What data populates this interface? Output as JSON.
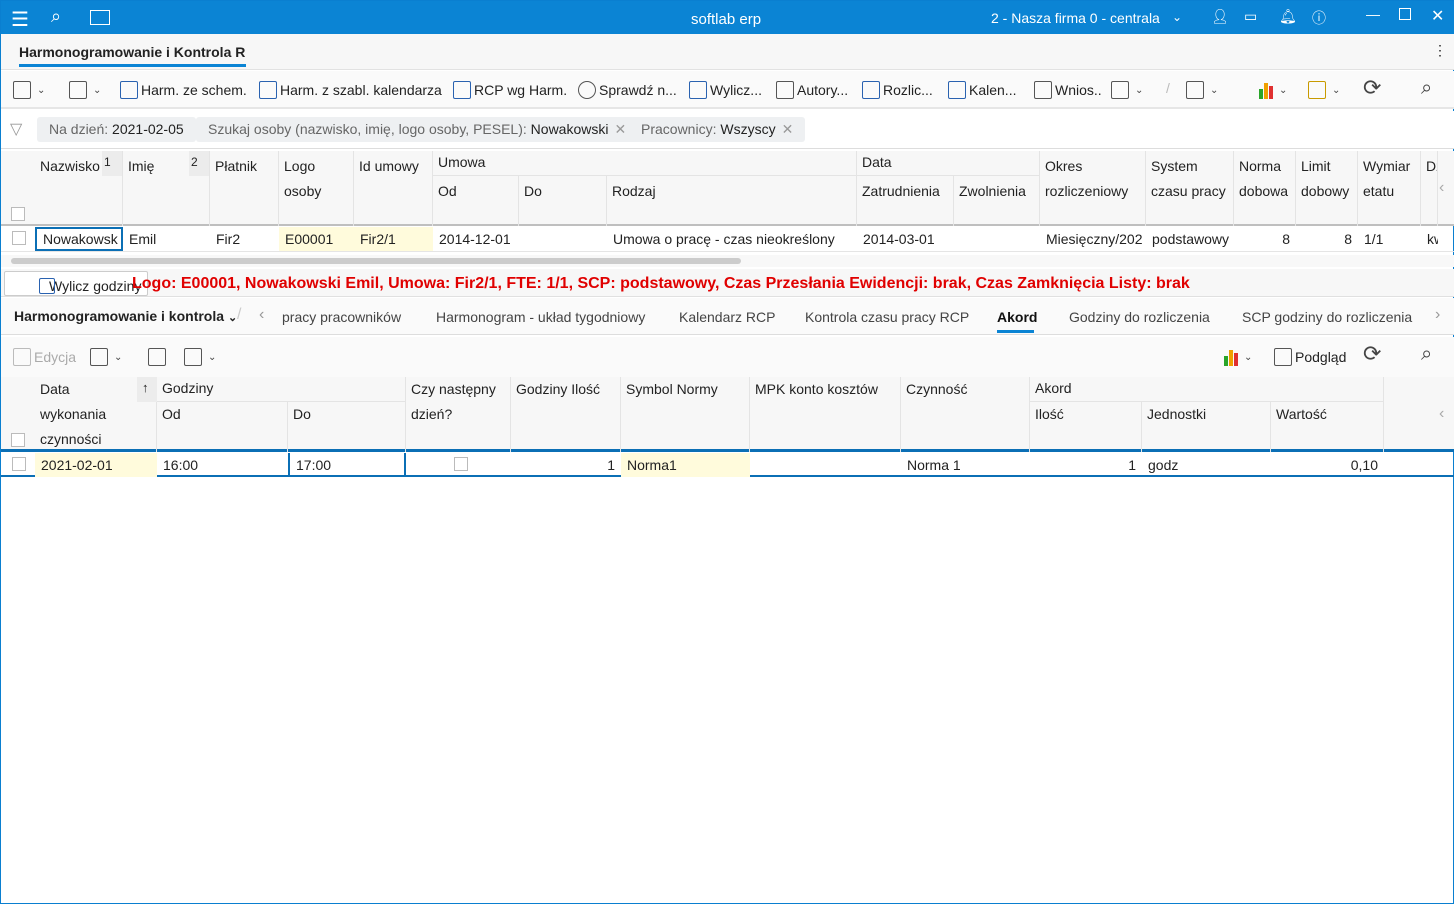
{
  "titlebar": {
    "app": "softlab erp",
    "company": "2 - Nasza firma 0 - centrala",
    "icons": [
      "menu-icon",
      "search-icon",
      "news-icon",
      "user-icon",
      "chat-icon",
      "bell-icon",
      "help-icon",
      "minimize-icon",
      "maximize-icon",
      "close-icon"
    ]
  },
  "doc_tab": {
    "label": "Harmonogramowanie i Kontrola RCP"
  },
  "toolbar": {
    "items": [
      "Harm. ze schem.",
      "Harm. z szabl. kalendarza",
      "RCP wg Harm.",
      "Sprawdź n...",
      "Wylicz...",
      "Autory...",
      "Rozlic...",
      "Kalen...",
      "Wnios.."
    ]
  },
  "filters": {
    "date_label": "Na dzień:",
    "date_value": "2021-02-05",
    "search_label": "Szukaj osoby (nazwisko, imię, logo osoby, PESEL):",
    "search_value": "Nowakowski",
    "workers_label": "Pracownicy:",
    "workers_value": "Wszyscy"
  },
  "top_grid": {
    "group_headers": {
      "umowa": "Umowa",
      "data": "Data"
    },
    "columns": [
      "Nazwisko",
      "Imię",
      "Płatnik",
      "Logo osoby",
      "Id umowy",
      "Od",
      "Do",
      "Rodzaj",
      "Zatrudnienia",
      "Zwolnienia",
      "Okres rozliczeniowy",
      "System czasu pracy",
      "Norma dobowa",
      "Limit dobowy",
      "Wymiar etatu",
      "Dz"
    ],
    "sort_markers": [
      "1",
      "2"
    ],
    "rows": [
      [
        "Nowakowsk",
        "Emil",
        "Fir2",
        "E00001",
        "Fir2/1",
        "2014-12-01",
        "",
        "Umowa o pracę - czas nieokreślony",
        "2014-03-01",
        "",
        "Miesięczny/202",
        "podstawowy",
        "8",
        "8",
        "1/1",
        "kwi"
      ]
    ]
  },
  "action": {
    "wylicz_label": "Wylicz godziny",
    "info": "Logo: E00001, Nowakowski Emil, Umowa: Fir2/1, FTE: 1/1, SCP: podstawowy, Czas Przesłania Ewidencji: brak, Czas Zamknięcia Listy: brak"
  },
  "subtabs": {
    "module": "Harmonogramowanie i kontrola",
    "items": [
      "pracy pracowników",
      "Harmonogram - układ tygodniowy",
      "Kalendarz RCP",
      "Kontrola czasu pracy RCP",
      "Akord",
      "Godziny do rozliczenia",
      "SCP godziny do rozliczenia"
    ],
    "active": "Akord"
  },
  "toolbar2": {
    "edit": "Edycja",
    "preview": "Podgląd"
  },
  "bottom_grid": {
    "group_headers": {
      "godziny": "Godziny",
      "akord": "Akord"
    },
    "columns": [
      "Data wykonania czynności",
      "Od",
      "Do",
      "Czy następny dzień?",
      "Godziny Ilość",
      "Symbol Normy",
      "MPK konto kosztów",
      "Czynność",
      "Ilość",
      "Jednostki",
      "Wartość"
    ],
    "rows": [
      [
        "2021-02-01",
        "16:00",
        "17:00",
        "",
        "1",
        "Norma1",
        "",
        "Norma 1",
        "1",
        "godz",
        "0,10"
      ]
    ]
  },
  "colors": {
    "accent": "#0b84d4",
    "info_red": "#e00000",
    "highlight": "#fffbdc"
  }
}
